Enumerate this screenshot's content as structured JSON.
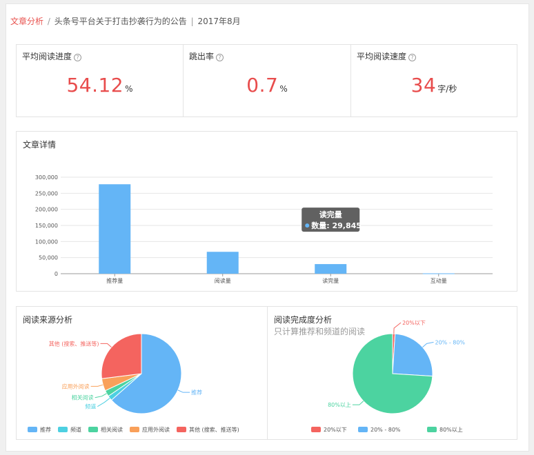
{
  "breadcrumb": {
    "section": "文章分析",
    "separator": "/",
    "article": "头条号平台关于打击抄袭行为的公告",
    "divider": "|",
    "period": "2017年8月"
  },
  "metrics": [
    {
      "label": "平均阅读进度",
      "value": "54.12",
      "unit": "%"
    },
    {
      "label": "跳出率",
      "value": "0.7",
      "unit": "%"
    },
    {
      "label": "平均阅读速度",
      "value": "34",
      "unit": "字/秒"
    }
  ],
  "help_glyph": "?",
  "detail": {
    "title": "文章详情",
    "tooltip": {
      "title": "读完量",
      "label": "数量: 29,845"
    }
  },
  "chart_data": [
    {
      "type": "bar",
      "title": "文章详情",
      "categories": [
        "推荐量",
        "阅读量",
        "读完量",
        "互动量"
      ],
      "values": [
        278000,
        68000,
        29845,
        1000
      ],
      "yticks": [
        "0",
        "50,000",
        "100,000",
        "150,000",
        "200,000",
        "250,000",
        "300,000"
      ],
      "ylim": [
        0,
        300000
      ],
      "grid": true,
      "color": "#64b5f6"
    },
    {
      "type": "pie",
      "title": "阅读来源分析",
      "slices": [
        {
          "name": "推荐",
          "value": 63.5,
          "color": "#64b5f6"
        },
        {
          "name": "频道",
          "value": 2.0,
          "color": "#4dd0e1"
        },
        {
          "name": "相关阅读",
          "value": 2.5,
          "color": "#4cd3a0"
        },
        {
          "name": "应用外阅读",
          "value": 5.0,
          "color": "#f9a05a"
        },
        {
          "name": "其他 (搜索、推送等)",
          "value": 27.0,
          "color": "#f4645f"
        }
      ],
      "legend_position": "bottom"
    },
    {
      "type": "pie",
      "title": "阅读完成度分析",
      "subtitle": "只计算推荐和频道的阅读",
      "slices": [
        {
          "name": "20%以下",
          "value": 1.0,
          "color": "#f4645f"
        },
        {
          "name": "20% - 80%",
          "value": 25.0,
          "color": "#64b5f6"
        },
        {
          "name": "80%以上",
          "value": 74.0,
          "color": "#4cd3a0"
        }
      ],
      "legend_position": "bottom"
    }
  ]
}
